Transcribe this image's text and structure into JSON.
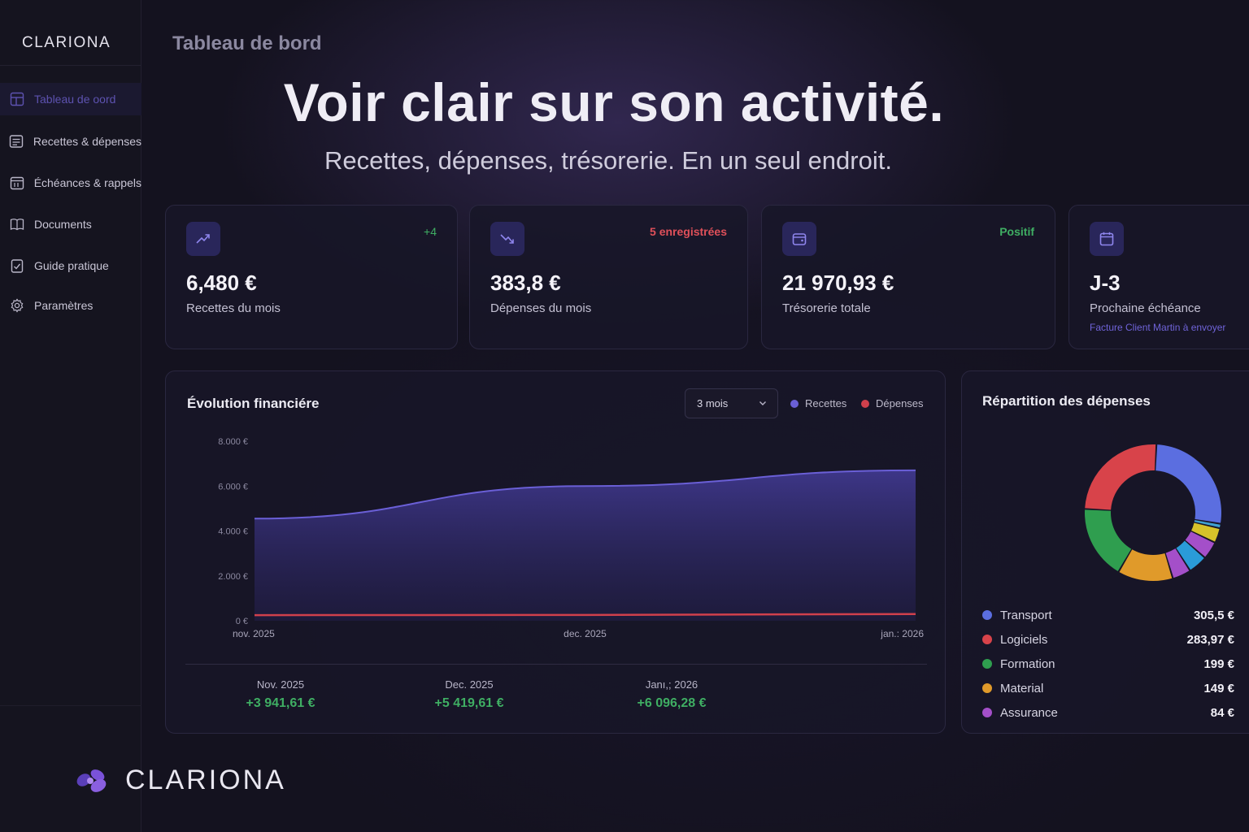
{
  "app": {
    "brand": "CLARIONA",
    "page_title": "Tableau de bord"
  },
  "sidebar": {
    "items": [
      {
        "label": "Tableau de oord",
        "icon": "dashboard-icon",
        "active": true
      },
      {
        "label": "Recettes & dépenses",
        "icon": "ledger-icon",
        "active": false
      },
      {
        "label": "Échéances & rappels",
        "icon": "calendar-icon",
        "active": false
      },
      {
        "label": "Documents",
        "icon": "book-icon",
        "active": false
      },
      {
        "label": "Guide pratique",
        "icon": "checklist-icon",
        "active": false
      },
      {
        "label": "Paramètres",
        "icon": "gear-icon",
        "active": false
      }
    ]
  },
  "hero": {
    "title": "Voir clair sur son activité.",
    "subtitle": "Recettes, dépenses, trésorerie. En un seul endroit."
  },
  "stats": [
    {
      "icon": "trend-up-icon",
      "badge": "+4",
      "badge_color": "#3fae63",
      "value": "6,480 €",
      "label": "Recettes du mois"
    },
    {
      "icon": "trend-down-icon",
      "badge": "5 enregistrées",
      "badge_color": "#e0505a",
      "value": "383,8 €",
      "label": "Dépenses du mois"
    },
    {
      "icon": "wallet-icon",
      "badge": "Positif",
      "badge_color": "#3fae63",
      "value": "21 970,93 €",
      "label": "Trésorerie totale"
    },
    {
      "icon": "calendar-icon",
      "badge": "",
      "value": "J-3",
      "label": "Prochaine échéance",
      "note": "Facture Client Martin à envoyer"
    }
  ],
  "evolution": {
    "title": "Évolution financiére",
    "period_select": "3 mois",
    "legend": [
      {
        "label": "Recettes",
        "color": "#6a5fd6"
      },
      {
        "label": "Dépenses",
        "color": "#d0404c"
      }
    ],
    "summary": [
      {
        "month": "Nov. 2025",
        "value": "+3 941,61 €"
      },
      {
        "month": "Dec. 2025",
        "value": "+5 419,61 €"
      },
      {
        "month": "Janı,; 2026",
        "value": "+6 096,28 €"
      }
    ]
  },
  "repartition": {
    "title": "Répartition des dépenses",
    "categories": [
      {
        "name": "Transport",
        "amount": "305,5 €",
        "color": "#5b6ee0"
      },
      {
        "name": "Logiciels",
        "amount": "283,97 €",
        "color": "#d8434a"
      },
      {
        "name": "Formation",
        "amount": "199 €",
        "color": "#2f9e4f"
      },
      {
        "name": "Material",
        "amount": "149 €",
        "color": "#e09a2a"
      },
      {
        "name": "Assurance",
        "amount": "84 €",
        "color": "#a44fc9"
      }
    ]
  },
  "chart_data": [
    {
      "type": "area",
      "title": "Évolution financiére",
      "x": [
        "nov. 2025",
        "dec. 2025",
        "jan. 2026"
      ],
      "x_tick_labels": [
        "nov. 2025",
        "dec. 2025",
        "jan.: 2026"
      ],
      "y_tick_labels": [
        "0 €",
        "2.000 €",
        "4.000 €",
        "6.000 €",
        "8.000 €"
      ],
      "ylim": [
        0,
        8000
      ],
      "grid": false,
      "legend_placement": "top-right",
      "series": [
        {
          "name": "Recettes",
          "color": "#6a5fd6",
          "values": [
            4550,
            6000,
            6700
          ]
        },
        {
          "name": "Dépenses",
          "color": "#d0404c",
          "values": [
            250,
            260,
            300
          ]
        }
      ]
    },
    {
      "type": "pie",
      "title": "Répartition des dépenses",
      "donut": true,
      "slices": [
        {
          "name": "Transport",
          "value": 305.5,
          "color": "#5b6ee0"
        },
        {
          "name": "",
          "value": 12,
          "color": "#3fa0d0"
        },
        {
          "name": "",
          "value": 40,
          "color": "#d6c22a"
        },
        {
          "name": "",
          "value": 48,
          "color": "#a44fc9"
        },
        {
          "name": "",
          "value": 52,
          "color": "#2a9bd8"
        },
        {
          "name": "",
          "value": 50,
          "color": "#a44fc9"
        },
        {
          "name": "Material",
          "value": 149,
          "color": "#e09a2a"
        },
        {
          "name": "Formation",
          "value": 199,
          "color": "#2f9e4f"
        },
        {
          "name": "Logiciels",
          "value": 283.97,
          "color": "#d8434a"
        }
      ]
    }
  ]
}
